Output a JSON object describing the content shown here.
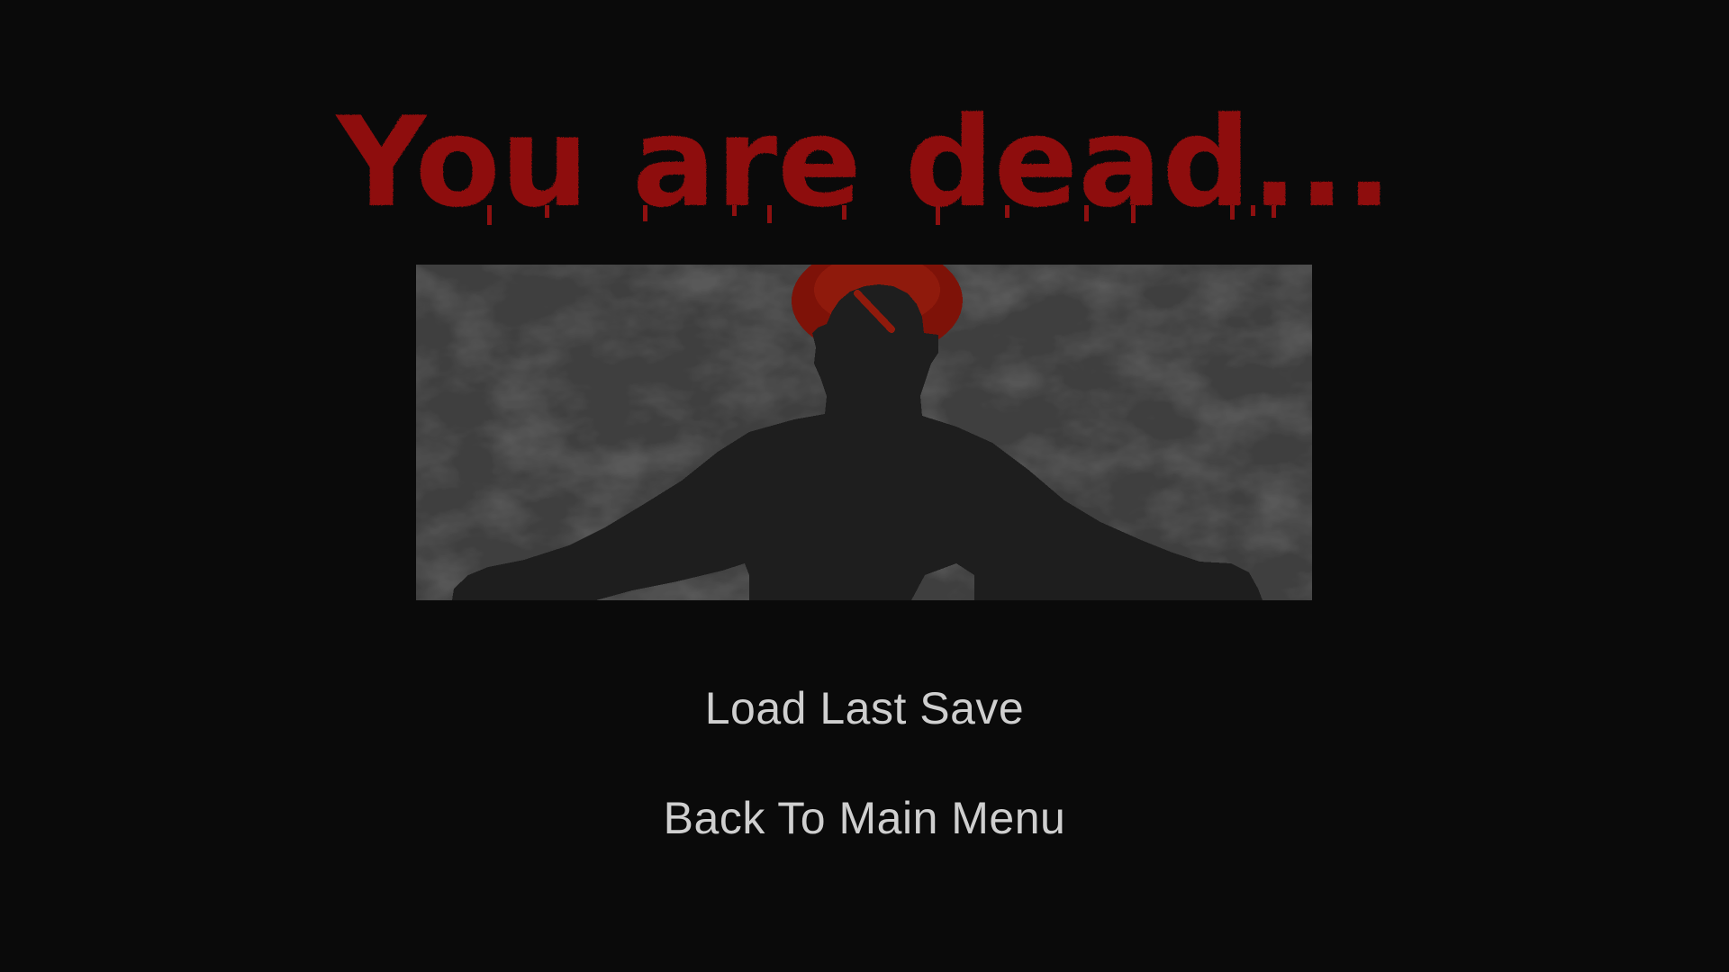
{
  "title": "You are dead...",
  "menu": {
    "options": [
      {
        "label": "Load Last Save"
      },
      {
        "label": "Back To Main Menu"
      }
    ]
  },
  "colors": {
    "background": "#0a0a0a",
    "title": "#8e1010",
    "menu_text": "#cfcfcf",
    "blood": "#8c1408",
    "silhouette": "#1e1e1e",
    "wall": "#3d3d3d"
  }
}
